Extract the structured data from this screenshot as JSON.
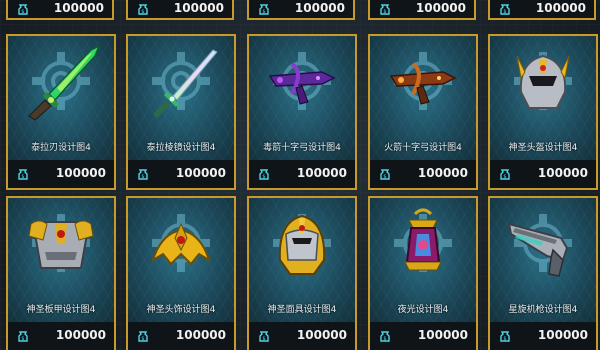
{
  "currency": {
    "icon": "coin-bag-icon",
    "color": "#4fd4e6"
  },
  "accent_color": "#c89a2a",
  "top_row": [
    {
      "price": "100000"
    },
    {
      "price": "100000"
    },
    {
      "price": "100000"
    },
    {
      "price": "100000"
    },
    {
      "price": "100000"
    }
  ],
  "items": [
    {
      "name": "泰拉刃设计图4",
      "price": "100000",
      "icon": "terra-blade-icon"
    },
    {
      "name": "泰拉棱镜设计图4",
      "price": "100000",
      "icon": "terraprisma-sword-icon"
    },
    {
      "name": "毒箭十字弓设计图4",
      "price": "100000",
      "icon": "poison-crossbow-icon"
    },
    {
      "name": "火箭十字弓设计图4",
      "price": "100000",
      "icon": "fire-crossbow-icon"
    },
    {
      "name": "神圣头盔设计图4",
      "price": "100000",
      "icon": "hallowed-helmet-icon"
    },
    {
      "name": "神圣板甲设计图4",
      "price": "100000",
      "icon": "hallowed-plate-armor-icon"
    },
    {
      "name": "神圣头饰设计图4",
      "price": "100000",
      "icon": "hallowed-headgear-icon"
    },
    {
      "name": "神圣面具设计图4",
      "price": "100000",
      "icon": "hallowed-mask-icon"
    },
    {
      "name": "夜光设计图4",
      "price": "100000",
      "icon": "lantern-icon"
    },
    {
      "name": "星旋机枪设计图4",
      "price": "100000",
      "icon": "vortex-gun-icon"
    }
  ]
}
